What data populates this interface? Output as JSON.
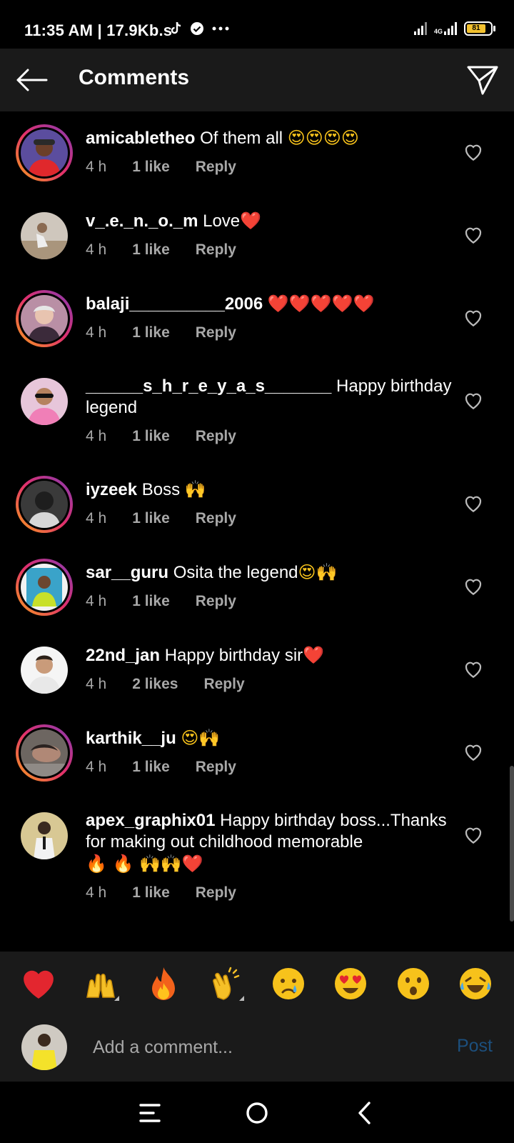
{
  "status_bar": {
    "time": "11:35 AM | 17.9Kb.s",
    "network_label": "4G",
    "battery_level": "81",
    "icons": [
      "tiktok-icon",
      "check-circle-icon",
      "more-dots-icon",
      "signal-icon",
      "signal-4g-icon",
      "battery-icon"
    ]
  },
  "header": {
    "title": "Comments",
    "back_icon": "arrow-left-icon",
    "send_icon": "paper-plane-icon"
  },
  "comments": [
    {
      "username": "amicabletheo",
      "text": "Of them all",
      "emojis": "😍😍😍😍",
      "time": "4 h",
      "likes": "1 like",
      "reply": "Reply",
      "story_ring": true
    },
    {
      "username": "v_.e._n._o._m",
      "text": "Love",
      "emojis": "❤️",
      "time": "4 h",
      "likes": "1 like",
      "reply": "Reply",
      "story_ring": false
    },
    {
      "username": "balaji__________2006",
      "text": "",
      "emojis": "❤️❤️❤️❤️❤️",
      "time": "4 h",
      "likes": "1 like",
      "reply": "Reply",
      "story_ring": true
    },
    {
      "username": "______s_h_r_e_y_a_s_______",
      "text": "Happy birthday legend",
      "emojis": "",
      "time": "4 h",
      "likes": "1 like",
      "reply": "Reply",
      "story_ring": false
    },
    {
      "username": "iyzeek",
      "text": "Boss",
      "emojis": "🙌",
      "time": "4 h",
      "likes": "1 like",
      "reply": "Reply",
      "story_ring": true
    },
    {
      "username": "sar__guru",
      "text": "Osita the legend",
      "emojis": "😍🙌",
      "time": "4 h",
      "likes": "1 like",
      "reply": "Reply",
      "story_ring": true
    },
    {
      "username": "22nd_jan",
      "text": "Happy birthday sir",
      "emojis": "❤️",
      "time": "4 h",
      "likes": "2 likes",
      "reply": "Reply",
      "story_ring": false
    },
    {
      "username": "karthik__ju",
      "text": "",
      "emojis": "😍🙌",
      "time": "4 h",
      "likes": "1 like",
      "reply": "Reply",
      "story_ring": true
    },
    {
      "username": "apex_graphix01",
      "text": "Happy birthday boss...Thanks for making out childhood memorable",
      "emojis": "🔥 🔥 🙌🙌❤️",
      "time": "4 h",
      "likes": "1 like",
      "reply": "Reply",
      "story_ring": false
    }
  ],
  "emoji_bar": [
    "❤️",
    "🙌",
    "🔥",
    "👏",
    "😢",
    "😍",
    "😮",
    "😂"
  ],
  "composer": {
    "placeholder": "Add a comment...",
    "post_label": "Post"
  },
  "nav": {
    "icons": [
      "menu-icon",
      "home-circle-icon",
      "back-chevron-icon"
    ]
  },
  "colors": {
    "background": "#000000",
    "header_bg": "#1a1a1a",
    "meta_text": "#a8a8a8",
    "post_disabled": "#1c4f7d",
    "heart": "#e0245e",
    "battery": "#f2c12e"
  }
}
